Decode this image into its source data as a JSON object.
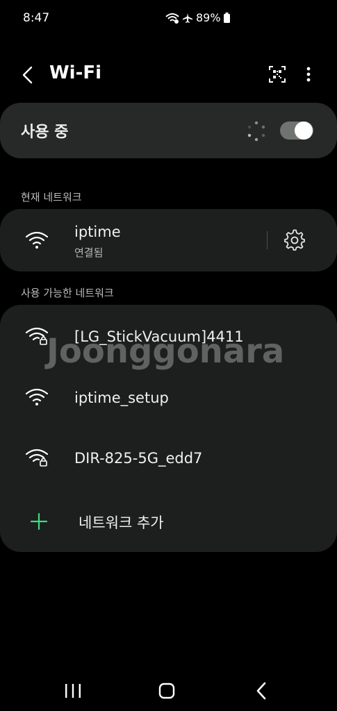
{
  "status_bar": {
    "time": "8:47",
    "battery_percent": "89%",
    "icons": [
      "wifi-calling-icon",
      "airplane-icon",
      "battery-icon"
    ]
  },
  "app_bar": {
    "title": "Wi-Fi",
    "icons": [
      "back-icon",
      "qr-code-icon",
      "more-vert-icon"
    ]
  },
  "wifi_toggle": {
    "label": "사용 중",
    "state": "on",
    "scanning": true
  },
  "current_network": {
    "header": "현재 네트워크",
    "name": "iptime",
    "status": "연결됨",
    "icon": "wifi-icon",
    "settings_icon": "gear-icon"
  },
  "available_networks": {
    "header": "사용 가능한 네트워크",
    "items": [
      {
        "name": "[LG_StickVacuum]4411",
        "icon": "wifi-lock-icon",
        "secured": true
      },
      {
        "name": "iptime_setup",
        "icon": "wifi-icon",
        "secured": false
      },
      {
        "name": "DIR-825-5G_edd7",
        "icon": "wifi-lock-icon",
        "secured": true
      }
    ],
    "add_label": "네트워크 추가",
    "add_icon": "plus-icon"
  },
  "watermark": "Joonggonara",
  "colors": {
    "background": "#000000",
    "card": "#1c1f1e",
    "toggle_card": "#262928",
    "accent_green": "#3ddc84",
    "secondary_text": "#b9bcbb"
  },
  "nav_bar": {
    "icons": [
      "recents-icon",
      "home-icon",
      "back-nav-icon"
    ]
  }
}
